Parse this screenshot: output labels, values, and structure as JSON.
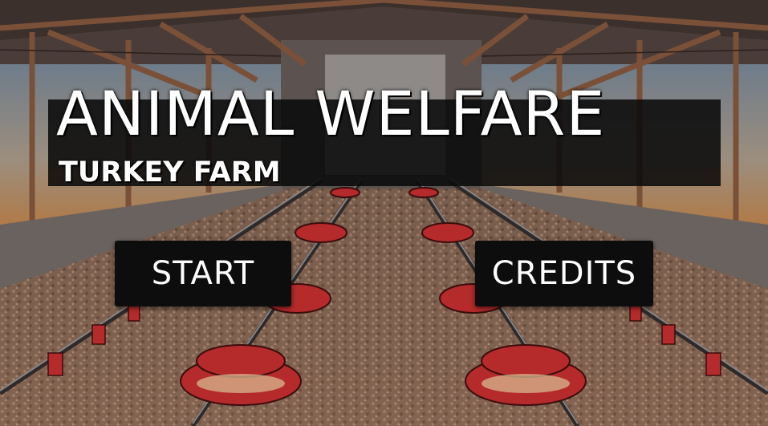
{
  "game": {
    "title": "ANIMAL WELFARE",
    "subtitle": "TURKEY FARM"
  },
  "menu": {
    "start_label": "START",
    "credits_label": "CREDITS"
  },
  "colors": {
    "panel": "#0d0d0d",
    "text": "#ffffff",
    "feeder_red": "#b52a2a",
    "litter": "#8a6a58",
    "roof_beam": "#7a5038"
  },
  "scene": {
    "setting": "turkey-barn-interior",
    "feeders": "red-pan-feeders",
    "pipes": "feeder-lines"
  }
}
